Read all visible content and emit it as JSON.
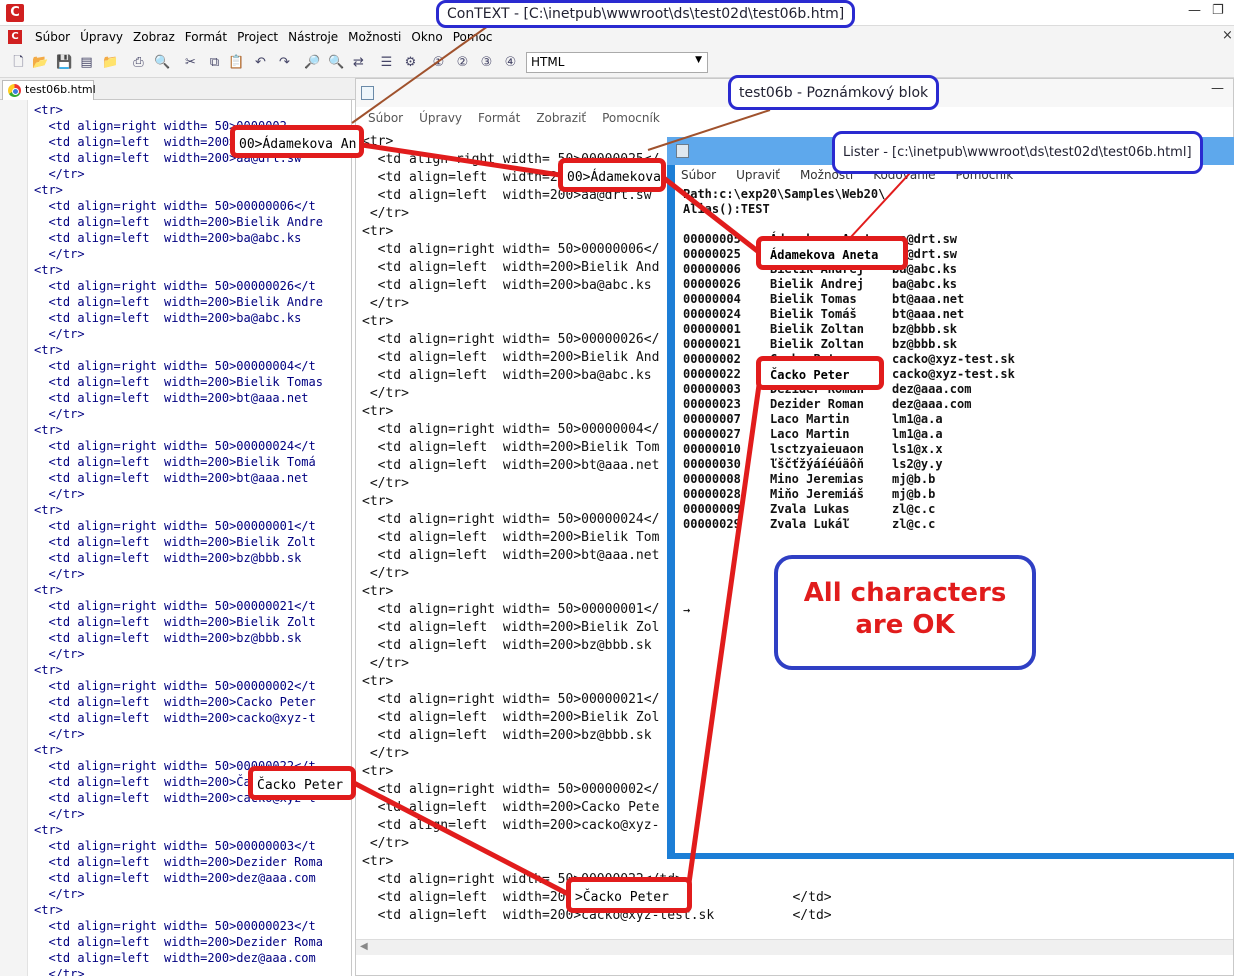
{
  "context_editor": {
    "title": "ConTEXT - [C:\\inetpub\\wwwroot\\ds\\test02d\\test06b.htm]",
    "menu": [
      "Súbor",
      "Úpravy",
      "Zobraz",
      "Formát",
      "Project",
      "Nástroje",
      "Možnosti",
      "Okno",
      "Pomoc"
    ],
    "highlighter": "HTML",
    "tab": "test06b.html",
    "lines": [
      "<tr>",
      "  <td align=right width= 50>0000002",
      "  <td align=left  width=200>Ádamekova An",
      "  <td align=left  width=200>aa@drt.sw",
      "  </tr>",
      "<tr>",
      "  <td align=right width= 50>00000006</t",
      "  <td align=left  width=200>Bielik Andre",
      "  <td align=left  width=200>ba@abc.ks",
      "  </tr>",
      "<tr>",
      "  <td align=right width= 50>00000026</t",
      "  <td align=left  width=200>Bielik Andre",
      "  <td align=left  width=200>ba@abc.ks",
      "  </tr>",
      "<tr>",
      "  <td align=right width= 50>00000004</t",
      "  <td align=left  width=200>Bielik Tomas",
      "  <td align=left  width=200>bt@aaa.net",
      "  </tr>",
      "<tr>",
      "  <td align=right width= 50>00000024</t",
      "  <td align=left  width=200>Bielik Tomá",
      "  <td align=left  width=200>bt@aaa.net",
      "  </tr>",
      "<tr>",
      "  <td align=right width= 50>00000001</t",
      "  <td align=left  width=200>Bielik Zolt",
      "  <td align=left  width=200>bz@bbb.sk",
      "  </tr>",
      "<tr>",
      "  <td align=right width= 50>00000021</t",
      "  <td align=left  width=200>Bielik Zolt",
      "  <td align=left  width=200>bz@bbb.sk",
      "  </tr>",
      "<tr>",
      "  <td align=right width= 50>00000002</t",
      "  <td align=left  width=200>Cacko Peter",
      "  <td align=left  width=200>cacko@xyz-t",
      "  </tr>",
      "<tr>",
      "  <td align=right width= 50>00000022</t",
      "  <td align=left  width=200>Čacko Peter",
      "  <td align=left  width=200>cacko@xyz-t",
      "  </tr>",
      "<tr>",
      "  <td align=right width= 50>00000003</t",
      "  <td align=left  width=200>Dezider Roma",
      "  <td align=left  width=200>dez@aaa.com",
      "  </tr>",
      "<tr>",
      "  <td align=right width= 50>00000023</t",
      "  <td align=left  width=200>Dezider Roma",
      "  <td align=left  width=200>dez@aaa.com",
      "  </tr>"
    ]
  },
  "notepad": {
    "title": "test06b - Poznámkový blok",
    "menu": [
      "Súbor",
      "Úpravy",
      "Formát",
      "Zobraziť",
      "Pomocník"
    ],
    "lines": [
      "<tr>",
      "  <td align=right width= 50>00000025</",
      "  <td align=left  width=200>Ádamekova",
      "  <td align=left  width=200>aa@drt.sw",
      " </tr>",
      "<tr>",
      "  <td align=right width= 50>00000006</",
      "  <td align=left  width=200>Bielik And",
      "  <td align=left  width=200>ba@abc.ks",
      " </tr>",
      "<tr>",
      "  <td align=right width= 50>00000026</",
      "  <td align=left  width=200>Bielik And",
      "  <td align=left  width=200>ba@abc.ks",
      " </tr>",
      "<tr>",
      "  <td align=right width= 50>00000004</",
      "  <td align=left  width=200>Bielik Tom",
      "  <td align=left  width=200>bt@aaa.net",
      " </tr>",
      "<tr>",
      "  <td align=right width= 50>00000024</",
      "  <td align=left  width=200>Bielik Tom",
      "  <td align=left  width=200>bt@aaa.net",
      " </tr>",
      "<tr>",
      "  <td align=right width= 50>00000001</",
      "  <td align=left  width=200>Bielik Zol",
      "  <td align=left  width=200>bz@bbb.sk",
      " </tr>",
      "<tr>",
      "  <td align=right width= 50>00000021</",
      "  <td align=left  width=200>Bielik Zol",
      "  <td align=left  width=200>bz@bbb.sk",
      " </tr>",
      "<tr>",
      "  <td align=right width= 50>00000002</",
      "  <td align=left  width=200>Cacko Pete",
      "  <td align=left  width=200>cacko@xyz-",
      " </tr>",
      "<tr>",
      "  <td align=right width= 50>00000022</td>",
      "  <td align=left  width=200>Čacko Peter                </td>",
      "  <td align=left  width=200>cacko@xyz-test.sk          </td>"
    ]
  },
  "lister": {
    "title": "Lister - [c:\\inetpub\\wwwroot\\ds\\test02d\\test06b.html]",
    "menu": [
      "Súbor",
      "Upraviť",
      "Možnosti",
      "Kódovanie",
      "Pomocník"
    ],
    "header_lines": [
      "Path:c:\\exp20\\Samples\\Web20\\",
      "Alias():TEST"
    ],
    "rows": [
      {
        "id": "00000005",
        "name": "Ádamekova Aneta",
        "email": "aa@drt.sw"
      },
      {
        "id": "00000025",
        "name": "Ádamekova Aneta",
        "email": "aa@drt.sw"
      },
      {
        "id": "00000006",
        "name": "Bielik Andrej",
        "email": "ba@abc.ks"
      },
      {
        "id": "00000026",
        "name": "Bielik Andrej",
        "email": "ba@abc.ks"
      },
      {
        "id": "00000004",
        "name": "Bielik Tomas",
        "email": "bt@aaa.net"
      },
      {
        "id": "00000024",
        "name": "Bielik Tomáš",
        "email": "bt@aaa.net"
      },
      {
        "id": "00000001",
        "name": "Bielik Zoltan",
        "email": "bz@bbb.sk"
      },
      {
        "id": "00000021",
        "name": "Bielik Zoltan",
        "email": "bz@bbb.sk"
      },
      {
        "id": "00000002",
        "name": "Cacko Peter",
        "email": "cacko@xyz-test.sk"
      },
      {
        "id": "00000022",
        "name": "Čacko Peter",
        "email": "cacko@xyz-test.sk"
      },
      {
        "id": "00000003",
        "name": "Dezider Roman",
        "email": "dez@aaa.com"
      },
      {
        "id": "00000023",
        "name": "Dezider Roman",
        "email": "dez@aaa.com"
      },
      {
        "id": "00000007",
        "name": "Laco Martin",
        "email": "lm1@a.a"
      },
      {
        "id": "00000027",
        "name": "Laco Martin",
        "email": "lm1@a.a"
      },
      {
        "id": "00000010",
        "name": "lsctzyaieuaon",
        "email": "ls1@x.x"
      },
      {
        "id": "00000030",
        "name": "ľščťžýáíéúäôň",
        "email": "ls2@y.y"
      },
      {
        "id": "00000008",
        "name": "Mino Jeremias",
        "email": "mj@b.b"
      },
      {
        "id": "00000028",
        "name": "Miňo Jeremiáš",
        "email": "mj@b.b"
      },
      {
        "id": "00000009",
        "name": "Zvala Lukas",
        "email": "zl@c.c"
      },
      {
        "id": "00000029",
        "name": "Zvala Lukáľ",
        "email": "zl@c.c"
      }
    ],
    "cursor": "→"
  },
  "annotations": {
    "highlight_adamekova_ctx": "00>Ádamekova An",
    "highlight_adamekova_np": "00>Ádamekova",
    "highlight_adamekova_lister": "Ádamekova Aneta",
    "highlight_cacko_ctx": "Čacko Peter",
    "highlight_cacko_np": ">Čacko Peter",
    "highlight_cacko_lister": "Čacko Peter",
    "message_line1": "All characters",
    "message_line2": "are OK",
    "color_red": "#e11c1c",
    "color_blue": "#2a2ad0"
  }
}
